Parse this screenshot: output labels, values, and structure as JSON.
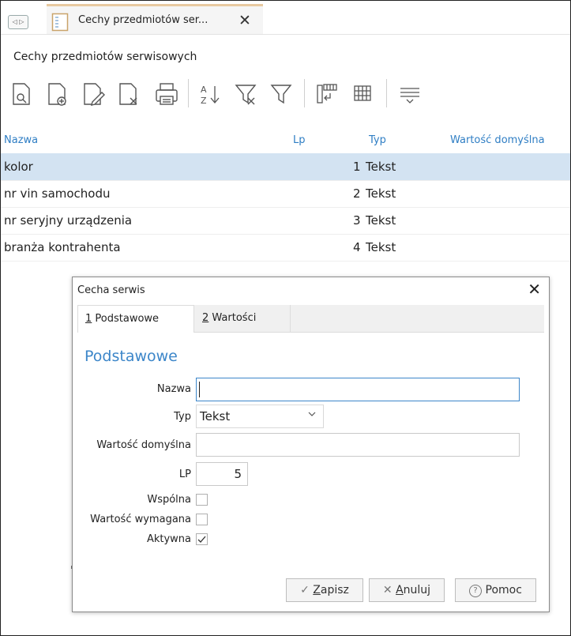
{
  "tab": {
    "title": "Cechy przedmiotów ser...",
    "close_glyph": "✕",
    "nav_glyph": "◁ ▷"
  },
  "module_title": "Cechy przedmiotów serwisowych",
  "toolbar_icons": [
    "view-icon",
    "add-icon",
    "edit-icon",
    "delete-icon",
    "print-icon",
    "sort-az-icon",
    "filter-clear-icon",
    "filter-icon",
    "insert-icon",
    "grid-icon",
    "totals-icon"
  ],
  "grid": {
    "headers": {
      "name": "Nazwa",
      "lp": "Lp",
      "type": "Typ",
      "default": "Wartość domyślna"
    },
    "rows": [
      {
        "name": "kolor",
        "lp": "1",
        "type": "Tekst"
      },
      {
        "name": "nr vin samochodu",
        "lp": "2",
        "type": "Tekst"
      },
      {
        "name": "nr seryjny urządzenia",
        "lp": "3",
        "type": "Tekst"
      },
      {
        "name": "branża kontrahenta",
        "lp": "4",
        "type": "Tekst"
      }
    ]
  },
  "dialog": {
    "title": "Cecha serwis",
    "close_glyph": "✕",
    "tabs": [
      {
        "key": "1",
        "label": " Podstawowe"
      },
      {
        "key": "2",
        "label": " Wartości"
      }
    ],
    "section": "Podstawowe",
    "fields": {
      "name_label": "Nazwa",
      "name_value": "",
      "type_label": "Typ",
      "type_value": "Tekst",
      "default_label": "Wartość domyślna",
      "default_value": "",
      "lp_label": "LP",
      "lp_value": "5",
      "common_label": "Wspólna",
      "required_label": "Wartość wymagana",
      "active_label": "Aktywna",
      "common_checked": false,
      "required_checked": false,
      "active_checked": true
    },
    "buttons": {
      "save_key": "Z",
      "save_rest": "apisz",
      "save_glyph": "✓",
      "cancel_key": "A",
      "cancel_rest": "nuluj",
      "cancel_glyph": "✕",
      "help_label": "Pomoc",
      "help_glyph": "?"
    }
  },
  "colors": {
    "accent": "#3c86c9",
    "selected_row": "#d3e3f2",
    "tab_accent": "#e8c9a0"
  }
}
